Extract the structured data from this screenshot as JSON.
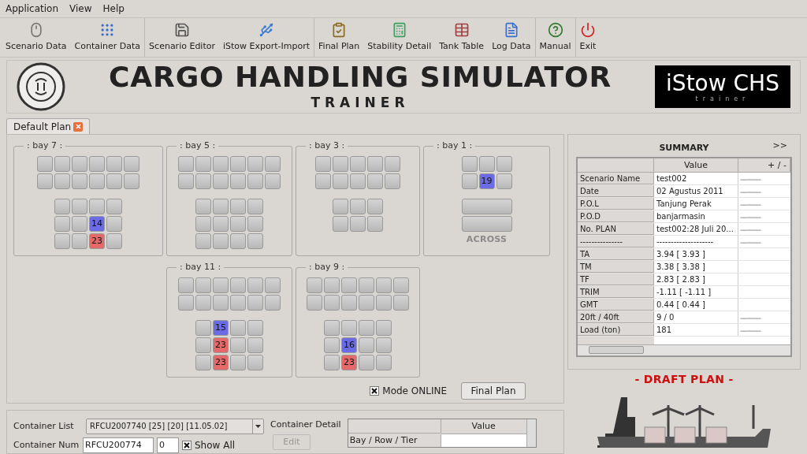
{
  "menu": [
    "Application",
    "View",
    "Help"
  ],
  "toolbar": [
    [
      {
        "label": "Scenario Data"
      },
      {
        "label": "Container Data"
      }
    ],
    [
      {
        "label": "Scenario Editor"
      },
      {
        "label": "iStow Export-Import"
      }
    ],
    [
      {
        "label": "Final Plan"
      },
      {
        "label": "Stability Detail"
      },
      {
        "label": "Tank Table"
      },
      {
        "label": "Log Data"
      }
    ],
    [
      {
        "label": "Manual"
      }
    ],
    [
      {
        "label": "Exit"
      }
    ]
  ],
  "banner": {
    "title": "CARGO HANDLING SIMULATOR",
    "subtitle": "TRAINER",
    "logo": "iStow CHS",
    "logo_sub": "trainer"
  },
  "tabs": [
    {
      "label": "Default Plan",
      "selected": true
    }
  ],
  "bays": [
    {
      "label": ": bay 7 :",
      "deck": [
        [
          {
            "kind": "empty"
          },
          {
            "kind": "empty"
          },
          {
            "kind": "empty"
          },
          {
            "kind": "empty"
          },
          {
            "kind": "empty"
          },
          {
            "kind": "empty"
          }
        ],
        [
          {
            "kind": "empty"
          },
          {
            "kind": "empty"
          },
          {
            "kind": "empty"
          },
          {
            "kind": "empty"
          },
          {
            "kind": "empty"
          },
          {
            "kind": "empty"
          }
        ]
      ],
      "hold": [
        [
          {
            "kind": "empty"
          },
          {
            "kind": "empty"
          },
          {
            "kind": "empty"
          },
          {
            "kind": "empty"
          }
        ],
        [
          {
            "kind": "empty"
          },
          {
            "kind": "empty"
          },
          {
            "kind": "loaded",
            "text": "14",
            "color": "#6b6be6"
          },
          {
            "kind": "empty"
          }
        ],
        [
          {
            "kind": "empty"
          },
          {
            "kind": "empty"
          },
          {
            "kind": "loaded",
            "text": "23",
            "color": "#e46a6a"
          },
          {
            "kind": "empty"
          }
        ]
      ]
    },
    {
      "label": ": bay 5 :",
      "deck": [
        [
          {
            "kind": "empty"
          },
          {
            "kind": "empty"
          },
          {
            "kind": "empty"
          },
          {
            "kind": "empty"
          },
          {
            "kind": "empty"
          },
          {
            "kind": "empty"
          }
        ],
        [
          {
            "kind": "empty"
          },
          {
            "kind": "empty"
          },
          {
            "kind": "empty"
          },
          {
            "kind": "empty"
          },
          {
            "kind": "empty"
          },
          {
            "kind": "empty"
          }
        ]
      ],
      "hold": [
        [
          {
            "kind": "empty"
          },
          {
            "kind": "empty"
          },
          {
            "kind": "empty"
          },
          {
            "kind": "empty"
          }
        ],
        [
          {
            "kind": "empty"
          },
          {
            "kind": "empty"
          },
          {
            "kind": "empty"
          },
          {
            "kind": "empty"
          }
        ],
        [
          {
            "kind": "empty"
          },
          {
            "kind": "empty"
          },
          {
            "kind": "empty"
          },
          {
            "kind": "empty"
          }
        ]
      ]
    },
    {
      "label": ": bay 3 :",
      "deck": [
        [
          {
            "kind": "empty"
          },
          {
            "kind": "empty"
          },
          {
            "kind": "empty"
          },
          {
            "kind": "empty"
          },
          {
            "kind": "empty"
          }
        ],
        [
          {
            "kind": "empty"
          },
          {
            "kind": "empty"
          },
          {
            "kind": "empty"
          },
          {
            "kind": "empty"
          },
          {
            "kind": "empty"
          }
        ]
      ],
      "hold": [
        [
          {
            "kind": "empty"
          },
          {
            "kind": "empty"
          },
          {
            "kind": "empty"
          }
        ],
        [
          {
            "kind": "empty"
          },
          {
            "kind": "empty"
          },
          {
            "kind": "empty"
          }
        ]
      ]
    },
    {
      "label": ": bay 1 :",
      "deck": [
        [
          {
            "kind": "empty"
          },
          {
            "kind": "empty"
          },
          {
            "kind": "empty"
          }
        ],
        [
          {
            "kind": "empty"
          },
          {
            "kind": "loaded",
            "text": "19",
            "color": "#6b6be6"
          },
          {
            "kind": "empty"
          }
        ]
      ],
      "across": "ACROSS"
    },
    {
      "label": ": bay 11 :",
      "deck": [
        [
          {
            "kind": "empty"
          },
          {
            "kind": "empty"
          },
          {
            "kind": "empty"
          },
          {
            "kind": "empty"
          },
          {
            "kind": "empty"
          },
          {
            "kind": "empty"
          }
        ],
        [
          {
            "kind": "empty"
          },
          {
            "kind": "empty"
          },
          {
            "kind": "empty"
          },
          {
            "kind": "empty"
          },
          {
            "kind": "empty"
          },
          {
            "kind": "empty"
          }
        ]
      ],
      "hold": [
        [
          {
            "kind": "empty"
          },
          {
            "kind": "loaded",
            "text": "15",
            "color": "#6b6be6"
          },
          {
            "kind": "empty"
          },
          {
            "kind": "empty"
          }
        ],
        [
          {
            "kind": "empty"
          },
          {
            "kind": "loaded",
            "text": "23",
            "color": "#e46a6a"
          },
          {
            "kind": "empty"
          },
          {
            "kind": "empty"
          }
        ],
        [
          {
            "kind": "empty"
          },
          {
            "kind": "loaded",
            "text": "23",
            "color": "#e46a6a"
          },
          {
            "kind": "empty"
          },
          {
            "kind": "empty"
          }
        ]
      ]
    },
    {
      "label": ": bay 9 :",
      "deck": [
        [
          {
            "kind": "empty"
          },
          {
            "kind": "empty"
          },
          {
            "kind": "empty"
          },
          {
            "kind": "empty"
          },
          {
            "kind": "empty"
          },
          {
            "kind": "empty"
          }
        ],
        [
          {
            "kind": "empty"
          },
          {
            "kind": "empty"
          },
          {
            "kind": "empty"
          },
          {
            "kind": "empty"
          },
          {
            "kind": "empty"
          },
          {
            "kind": "empty"
          }
        ]
      ],
      "hold": [
        [
          {
            "kind": "empty"
          },
          {
            "kind": "empty"
          },
          {
            "kind": "empty"
          },
          {
            "kind": "empty"
          }
        ],
        [
          {
            "kind": "empty"
          },
          {
            "kind": "loaded",
            "text": "16",
            "color": "#6b6be6"
          },
          {
            "kind": "empty"
          },
          {
            "kind": "empty"
          }
        ],
        [
          {
            "kind": "empty"
          },
          {
            "kind": "loaded",
            "text": "23",
            "color": "#e46a6a"
          },
          {
            "kind": "empty"
          },
          {
            "kind": "empty"
          }
        ]
      ]
    }
  ],
  "mode_online": {
    "label": "Mode ONLINE",
    "checked": true
  },
  "final_plan_button": "Final Plan",
  "summary": {
    "title": "SUMMARY",
    "expand": ">>",
    "columns": [
      "Value",
      "+ / -"
    ],
    "rows": [
      {
        "label": "Scenario Name",
        "value": "test002",
        "delta": "-----------------"
      },
      {
        "label": "Date",
        "value": "02 Agustus 2011",
        "delta": "-----------------"
      },
      {
        "label": "P.O.L",
        "value": "Tanjung Perak",
        "delta": "-----------------"
      },
      {
        "label": "P.O.D",
        "value": "banjarmasin",
        "delta": "-----------------"
      },
      {
        "label": "No. PLAN",
        "value": "test002:28 Juli 20...",
        "delta": "-----------------"
      },
      {
        "label": "---------------",
        "value": "--------------------",
        "delta": "-----------------"
      },
      {
        "label": "TA",
        "value": "3.94 [ 3.93 ]"
      },
      {
        "label": "TM",
        "value": "3.38 [ 3.38 ]"
      },
      {
        "label": "TF",
        "value": "2.83 [ 2.83 ]"
      },
      {
        "label": "TRIM",
        "value": "-1.11 [ -1.11 ]"
      },
      {
        "label": "GMT",
        "value": "0.44 [ 0.44 ]"
      },
      {
        "label": "20ft / 40ft",
        "value": "9 / 0",
        "delta": "-----------------"
      },
      {
        "label": "Load (ton)",
        "value": "181",
        "delta": "-----------------"
      }
    ]
  },
  "draft_plan": "- DRAFT PLAN -",
  "container_list": {
    "label": "Container List",
    "value": "RFCU2007740 [25] [20] [11.05.02]"
  },
  "container_number": {
    "label": "Container Num",
    "value": "RFCU200774",
    "count": "0"
  },
  "show_all": {
    "label": "Show All",
    "checked": true
  },
  "container_detail": {
    "label": "Container Detail",
    "edit": "Edit",
    "columns": [
      "Value"
    ],
    "rows": [
      "Bay / Row / Tier"
    ]
  }
}
